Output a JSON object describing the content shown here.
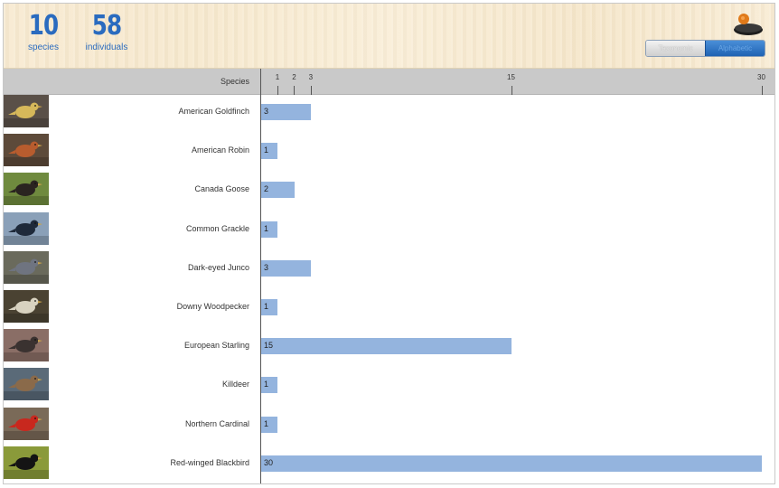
{
  "summary": {
    "species_count": "10",
    "species_label": "species",
    "individuals_count": "58",
    "individuals_label": "individuals"
  },
  "toggle": {
    "options": [
      "Taxonomic",
      "Alphabetic"
    ],
    "selected": "Alphabetic"
  },
  "table": {
    "species_header": "Species",
    "axis_ticks": [
      "1",
      "2",
      "3",
      "15",
      "30"
    ],
    "max": 30,
    "rows": [
      {
        "name": "American Goldfinch",
        "count": "3",
        "value": 3,
        "photo": "goldfinch-photo",
        "bg": "#5a5048",
        "bird": "#d6b85a"
      },
      {
        "name": "American Robin",
        "count": "1",
        "value": 1,
        "photo": "robin-photo",
        "bg": "#5d4a3a",
        "bird": "#b85c2e"
      },
      {
        "name": "Canada Goose",
        "count": "2",
        "value": 2,
        "photo": "goose-photo",
        "bg": "#6f8a3e",
        "bird": "#2a2420"
      },
      {
        "name": "Common Grackle",
        "count": "1",
        "value": 1,
        "photo": "grackle-photo",
        "bg": "#8aa0b8",
        "bird": "#1f2a3a"
      },
      {
        "name": "Dark-eyed Junco",
        "count": "3",
        "value": 3,
        "photo": "junco-photo",
        "bg": "#6a6a5c",
        "bird": "#6f7480"
      },
      {
        "name": "Downy Woodpecker",
        "count": "1",
        "value": 1,
        "photo": "woodpecker-photo",
        "bg": "#4a4232",
        "bird": "#d8d2c0"
      },
      {
        "name": "European Starling",
        "count": "15",
        "value": 15,
        "photo": "starling-photo",
        "bg": "#8a6e66",
        "bird": "#3a3230"
      },
      {
        "name": "Killdeer",
        "count": "1",
        "value": 1,
        "photo": "killdeer-photo",
        "bg": "#5a6a78",
        "bird": "#8a6a4a"
      },
      {
        "name": "Northern Cardinal",
        "count": "1",
        "value": 1,
        "photo": "cardinal-photo",
        "bg": "#7a6a58",
        "bird": "#c8281e"
      },
      {
        "name": "Red-winged Blackbird",
        "count": "30",
        "value": 30,
        "photo": "blackbird-photo",
        "bg": "#8a9a3a",
        "bird": "#141414"
      }
    ]
  },
  "colors": {
    "accent": "#2a6bbf",
    "bar": "#94b4de",
    "header_bar": "#c9c9c9"
  }
}
